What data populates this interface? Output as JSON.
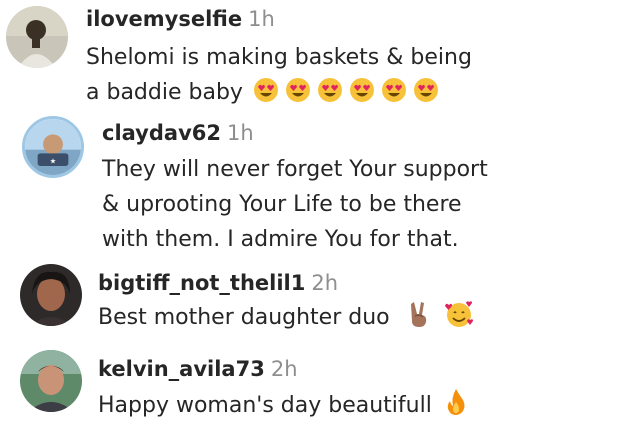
{
  "comments": [
    {
      "username": "ilovemyselfie",
      "time": "1h",
      "lines": [
        "Shelomi is making baskets & being",
        "a baddie baby"
      ],
      "emojis": [
        "heart-eyes-emoji",
        "heart-eyes-emoji",
        "heart-eyes-emoji",
        "heart-eyes-emoji",
        "heart-eyes-emoji",
        "heart-eyes-emoji"
      ]
    },
    {
      "username": "claydav62",
      "time": "1h",
      "lines": [
        "They will never forget Your support",
        "& uprooting Your Life to be there",
        "with them. I admire You for that."
      ],
      "emojis": []
    },
    {
      "username": "bigtiff_not_thelil1",
      "time": "2h",
      "lines": [
        "Best mother daughter duo"
      ],
      "emojis": [
        "victory-hand-emoji",
        "smiling-face-with-hearts-emoji"
      ]
    },
    {
      "username": "kelvin_avila73",
      "time": "2h",
      "lines": [
        "Happy woman's day beautifull"
      ],
      "emojis": [
        "fire-emoji"
      ]
    }
  ],
  "colors": {
    "text": "#262626",
    "muted": "#8e8e8e",
    "emoji_yellow": "#f7c239",
    "emoji_heart": "#e0245e",
    "fire": "#f4900c"
  }
}
